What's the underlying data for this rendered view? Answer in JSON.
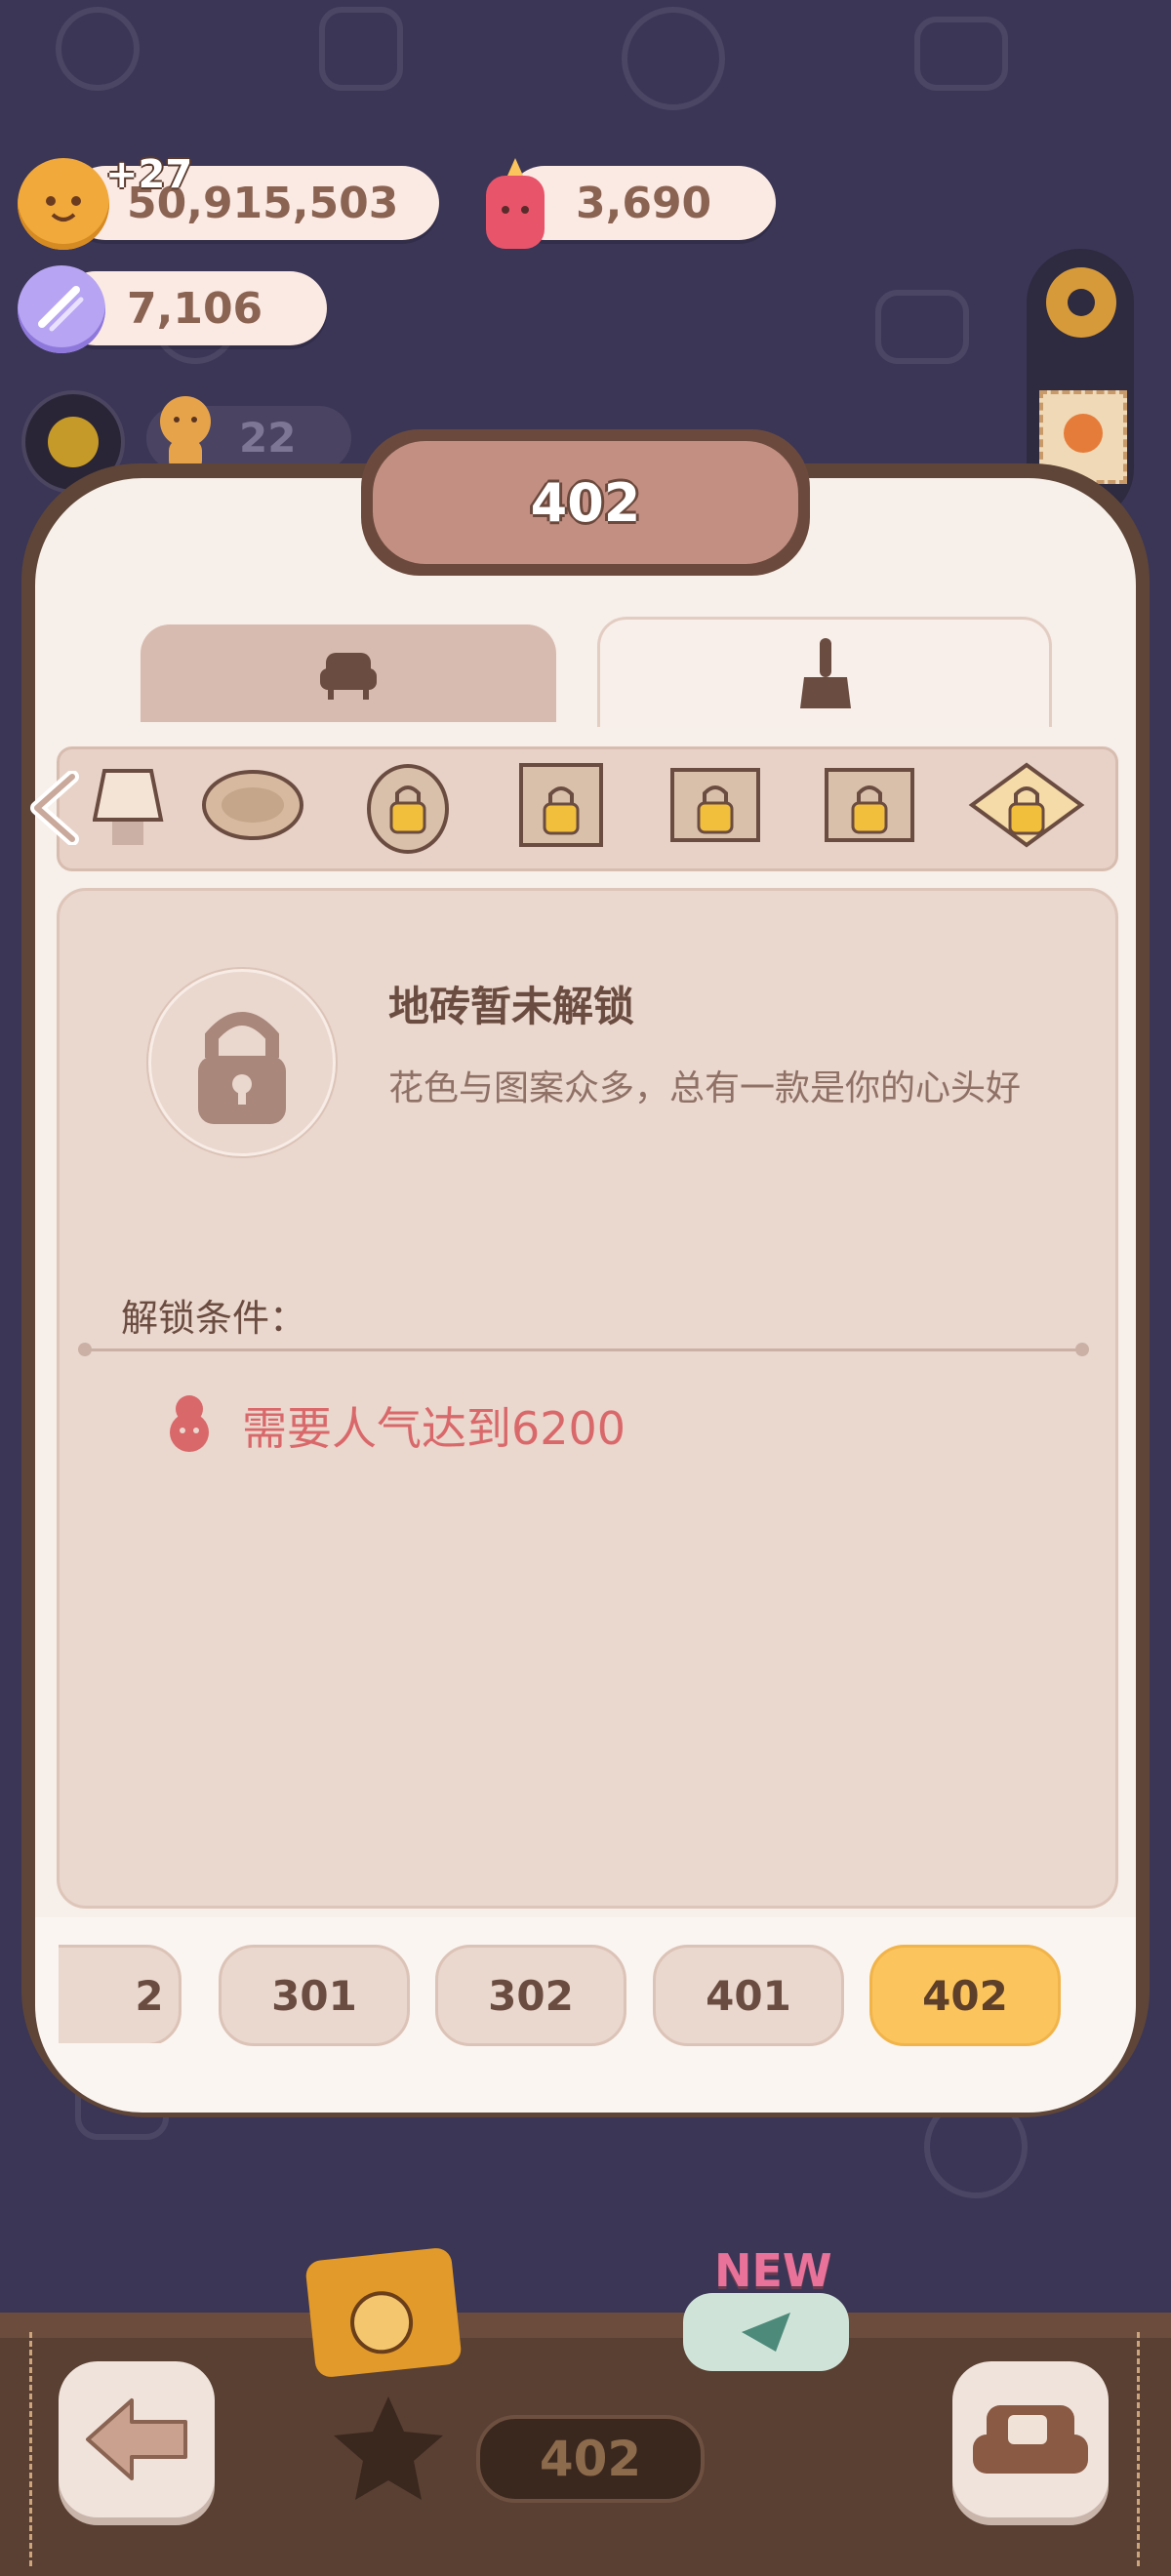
{
  "currencies": {
    "coins": {
      "value": "50,915,503",
      "gain": "+27"
    },
    "gems": {
      "value": "3,690"
    },
    "candy": {
      "value": "7,106"
    },
    "visitors": {
      "value": "22"
    }
  },
  "dialog": {
    "title": "402",
    "tabs": [
      {
        "name": "furniture",
        "icon": "armchair-icon"
      },
      {
        "name": "decor",
        "icon": "brush-icon"
      }
    ],
    "strip_items": [
      {
        "icon": "lamp-icon",
        "locked": false
      },
      {
        "icon": "round-rug-icon",
        "locked": false
      },
      {
        "icon": "locked-round-icon",
        "locked": true
      },
      {
        "icon": "locked-frame-icon",
        "locked": true
      },
      {
        "icon": "locked-frame-icon",
        "locked": true
      },
      {
        "icon": "locked-frame-icon",
        "locked": true
      },
      {
        "icon": "locked-diamond-icon",
        "locked": true
      }
    ],
    "content": {
      "heading": "地砖暂未解锁",
      "description": "花色与图案众多，总有一款是你的心头好",
      "condition_label": "解锁条件：",
      "condition_text": "需要人气达到6200"
    },
    "rooms": [
      "2",
      "301",
      "302",
      "401",
      "402"
    ],
    "active_room": "402"
  },
  "footer": {
    "room_label": "402",
    "new_badge": "NEW"
  },
  "colors": {
    "background": "#3b3656",
    "panel": "#f7efe9",
    "active_tab": "#fcc45c",
    "condition": "#d9686a"
  }
}
